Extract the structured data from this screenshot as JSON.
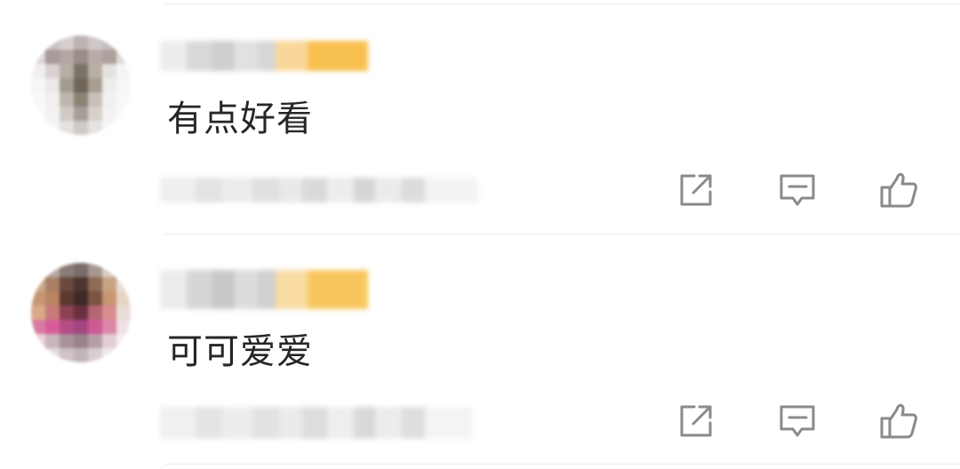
{
  "comments": [
    {
      "text": "有点好看",
      "actions": {
        "share_icon": "share-icon",
        "reply_icon": "reply-icon",
        "like_icon": "like-icon"
      }
    },
    {
      "text": "可可爱爱",
      "actions": {
        "share_icon": "share-icon",
        "reply_icon": "reply-icon",
        "like_icon": "like-icon"
      }
    }
  ],
  "colors": {
    "icon": "#8a8a8a",
    "badge": "#f7bf4e",
    "text": "#262626",
    "divider": "#ececec"
  }
}
